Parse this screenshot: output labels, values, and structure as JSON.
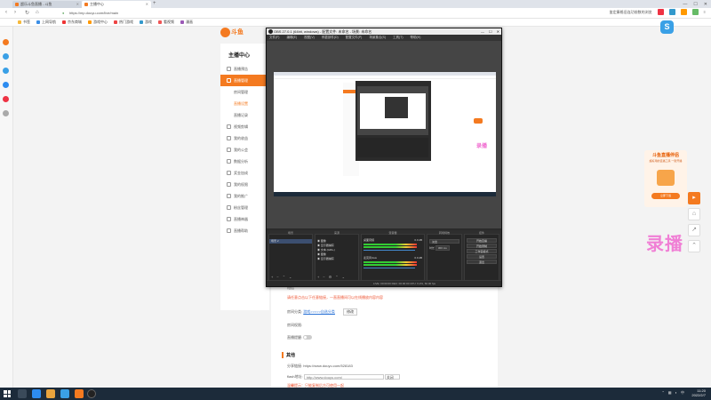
{
  "browser": {
    "tabs": [
      {
        "label": "超乐斗鱼直播 - 斗鱼"
      },
      {
        "label": "主播中心"
      }
    ],
    "address": "https://mp.douyu.com/live/main",
    "search_placeholder": "鉴定康格旧连功前数的浏览",
    "bookmarks": [
      "书签",
      "上网导航",
      "京东商城",
      "游戏中心",
      "热门游戏",
      "游戏",
      "看视频",
      "漫画"
    ]
  },
  "site": {
    "logo_text": "斗鱼",
    "anchor_center_title": "主播中心",
    "menu": [
      {
        "label": "直播预告",
        "active": false,
        "sub": false
      },
      {
        "label": "直播管理",
        "active": true,
        "sub": false
      },
      {
        "label": "房间管理",
        "active": false,
        "sub": true
      },
      {
        "label": "直播设置",
        "active": false,
        "sub": true,
        "highlight": true
      },
      {
        "label": "直播记录",
        "active": false,
        "sub": true
      },
      {
        "label": "视频剪辑",
        "active": false,
        "sub": false,
        "badge": "NEW"
      },
      {
        "label": "我的收益",
        "active": false,
        "sub": false
      },
      {
        "label": "我的公会",
        "active": false,
        "sub": false
      },
      {
        "label": "数据分析",
        "active": false,
        "sub": false
      },
      {
        "label": "奖金加成",
        "active": false,
        "sub": false
      },
      {
        "label": "我的权限",
        "active": false,
        "sub": false
      },
      {
        "label": "我的推广",
        "active": false,
        "sub": false
      },
      {
        "label": "粉丝管理",
        "active": false,
        "sub": false
      },
      {
        "label": "直播神器",
        "active": false,
        "sub": false
      },
      {
        "label": "直播帮助",
        "active": false,
        "sub": false
      }
    ],
    "form": {
      "notice_label": "短信",
      "notice_text": "请任意点击以下任意链接，一直直播间可以在线播放内容内容",
      "room_link_label": "房间分类:",
      "room_link_value": "游戏>>>>>自选分类",
      "room_link_btn": "修改",
      "room_perm_label": "房间权限:",
      "live_reminder_label": "直播提醒:",
      "section_other": "其他",
      "share_label": "分享链接:",
      "share_value": "https://www.douyu.com/528183",
      "flash_label": "flash地址:",
      "flash_value": "http://www.douyu.com/",
      "flash_select": "关闭",
      "flash_hint": "温馨提示：只能复制后方可使用一起"
    },
    "promo": {
      "title": "斗鱼直播伴侣",
      "subtitle": "超好用的直播工具 一键开播",
      "button": "立即下载"
    },
    "watermark": "录播"
  },
  "obs": {
    "title": "OBS 27.0.1 (64bit, windows) - 配置文件: 未命名 - 场景: 未命名",
    "menu": [
      "文件(F)",
      "编辑(E)",
      "视图(V)",
      "停靠部件(D)",
      "配置文件(P)",
      "场景集合(S)",
      "工具(T)",
      "帮助(H)"
    ],
    "docks": {
      "scenes_title": "场景",
      "scenes": [
        "场景 2"
      ],
      "sources_title": "来源",
      "sources": [
        "图像",
        "显示器捕获",
        "文本 (GDI+)",
        "图像",
        "显示器捕获"
      ],
      "mixer_title": "混音器",
      "mixer": [
        {
          "name": "桌面音频",
          "db": "0.0 dB"
        },
        {
          "name": "麦克风/Aux",
          "db": "0.0 dB"
        }
      ],
      "transitions_title": "转场特效",
      "transition_name": "淡出",
      "duration_label": "时长",
      "duration_value": "300 ms",
      "controls_title": "控件",
      "controls": [
        "开始直播",
        "开始录制",
        "工作室模式",
        "设置",
        "退出"
      ]
    },
    "status": "LIVE: 00:00:00   REC: 00:00:00   CPU: 6.2%, 60.00 fps"
  },
  "taskbar": {
    "time": "11:20",
    "date": "2022/2/7"
  }
}
